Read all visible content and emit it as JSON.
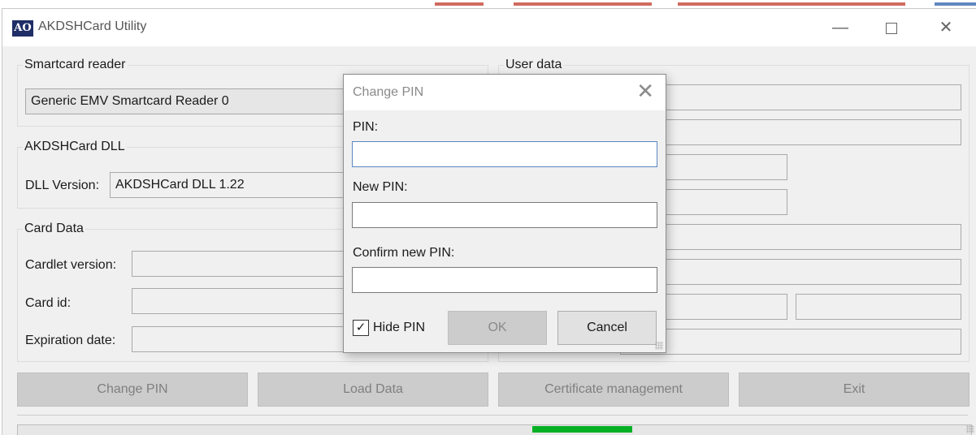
{
  "window": {
    "title": "AKDSHCard Utility",
    "icon_text": "AO"
  },
  "smartcard_reader": {
    "legend": "Smartcard reader",
    "selected": "Generic EMV Smartcard Reader 0"
  },
  "dll": {
    "legend": "AKDSHCard DLL",
    "version_label": "DLL Version:",
    "version_value": "AKDSHCard DLL 1.22"
  },
  "card_data": {
    "legend": "Card Data",
    "cardlet_label": "Cardlet version:",
    "card_id_label": "Card id:",
    "expiration_label": "Expiration date:"
  },
  "user_data": {
    "legend": "User data"
  },
  "buttons": {
    "change_pin": "Change PIN",
    "load_data": "Load Data",
    "certificate_management": "Certificate management",
    "exit": "Exit"
  },
  "progress": {
    "fraction_start": 0.54,
    "fraction_end": 0.645
  },
  "dialog": {
    "title": "Change PIN",
    "pin_label": "PIN:",
    "new_pin_label": "New PIN:",
    "confirm_label": "Confirm new PIN:",
    "hide_pin_label": "Hide PIN",
    "hide_pin_checked": true,
    "ok": "OK",
    "cancel": "Cancel"
  },
  "colors": {
    "progress": "#06b025",
    "focus": "#5a87c2"
  }
}
